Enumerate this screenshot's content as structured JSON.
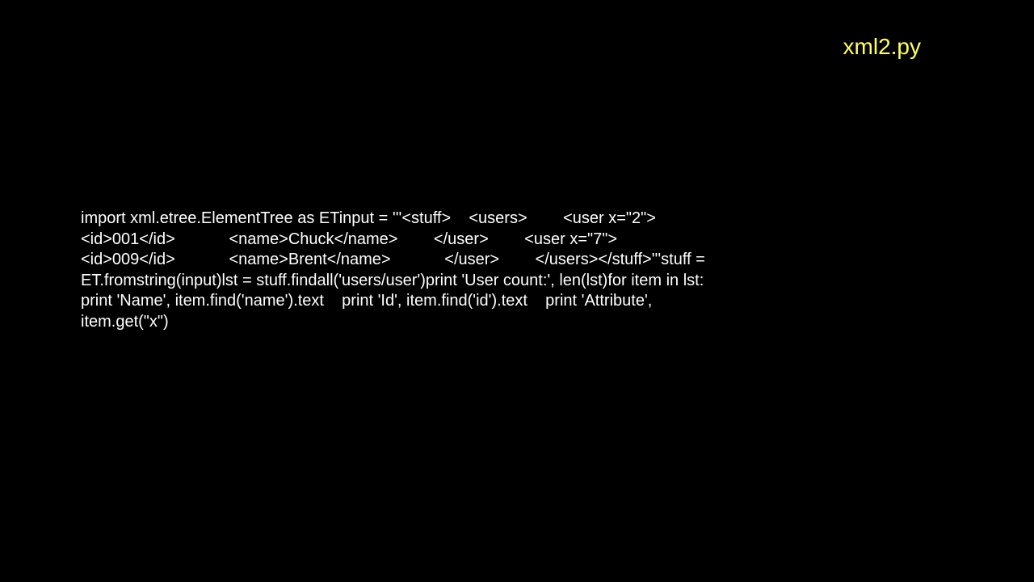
{
  "title": "xml2.py",
  "code": "import xml.etree.ElementTree as ETinput = '''<stuff>    <users>        <user x=\"2\">            <id>001</id>            <name>Chuck</name>        </user>        <user x=\"7\">            <id>009</id>            <name>Brent</name>            </user>        </users></stuff>'''stuff = ET.fromstring(input)lst = stuff.findall('users/user')print 'User count:', len(lst)for item in lst:    print 'Name', item.find('name').text    print 'Id', item.find('id').text    print 'Attribute', item.get(\"x\")"
}
